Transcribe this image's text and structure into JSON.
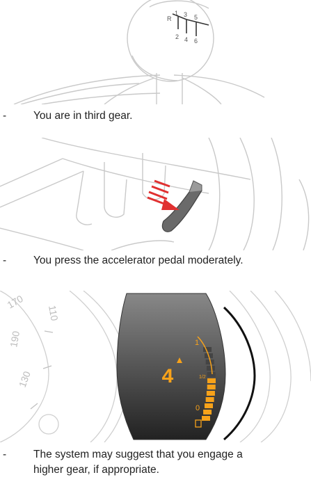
{
  "steps": [
    {
      "bullet": "-",
      "text": "You are in third gear."
    },
    {
      "bullet": "-",
      "text": "You press the accelerator pedal moderately."
    },
    {
      "bullet": "-",
      "text_line1": "The system may suggest that you engage a",
      "text_line2": "higher gear, if appropriate."
    }
  ],
  "gearknob": {
    "labels": [
      "R",
      "1",
      "3",
      "5",
      "2",
      "4",
      "6"
    ]
  },
  "display": {
    "gear": "4",
    "fuel_half": "1/2",
    "fuel_full_mark": "1",
    "fuel_empty_mark": "0",
    "fuel_level": 0.62,
    "accent_color": "#f7a21a"
  },
  "speedo": {
    "ticks": [
      "170",
      "110",
      "190",
      "130"
    ]
  }
}
